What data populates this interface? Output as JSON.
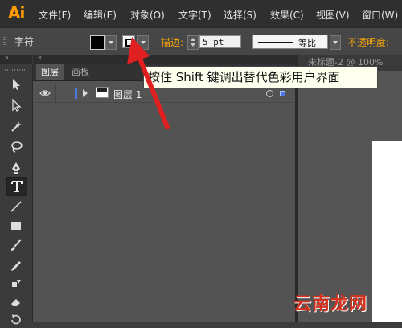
{
  "app": {
    "logo": "Ai"
  },
  "menubar": {
    "items": [
      "文件(F)",
      "编辑(E)",
      "对象(O)",
      "文字(T)",
      "选择(S)",
      "效果(C)",
      "视图(V)",
      "窗口(W)"
    ]
  },
  "controlbar": {
    "label": "字符",
    "stroke_label": "描边:",
    "stroke_value": "5 pt",
    "profile_label": "等比",
    "opacity_label": "不透明度:",
    "colors": {
      "fill": "#000000",
      "accent": "#f2a20c"
    }
  },
  "layers_panel": {
    "tabs": [
      "图层",
      "画板"
    ],
    "layers": [
      {
        "name": "图层 1",
        "color": "#4c78e0"
      }
    ]
  },
  "document": {
    "tab_title": "未标题-2 @ 100%"
  },
  "tooltip": {
    "text": "按住 Shift 键调出替代色彩用户界面"
  },
  "annotation": {
    "arrow_color": "#e02020"
  },
  "watermark": {
    "text": "云南龙网"
  },
  "tools": {
    "icons": [
      "selection-icon",
      "direct-selection-icon",
      "magic-wand-icon",
      "lasso-icon",
      "pen-icon",
      "type-icon",
      "line-segment-icon",
      "rectangle-icon",
      "paintbrush-icon",
      "pencil-icon",
      "blob-brush-icon",
      "eraser-icon",
      "rotate-icon"
    ]
  }
}
